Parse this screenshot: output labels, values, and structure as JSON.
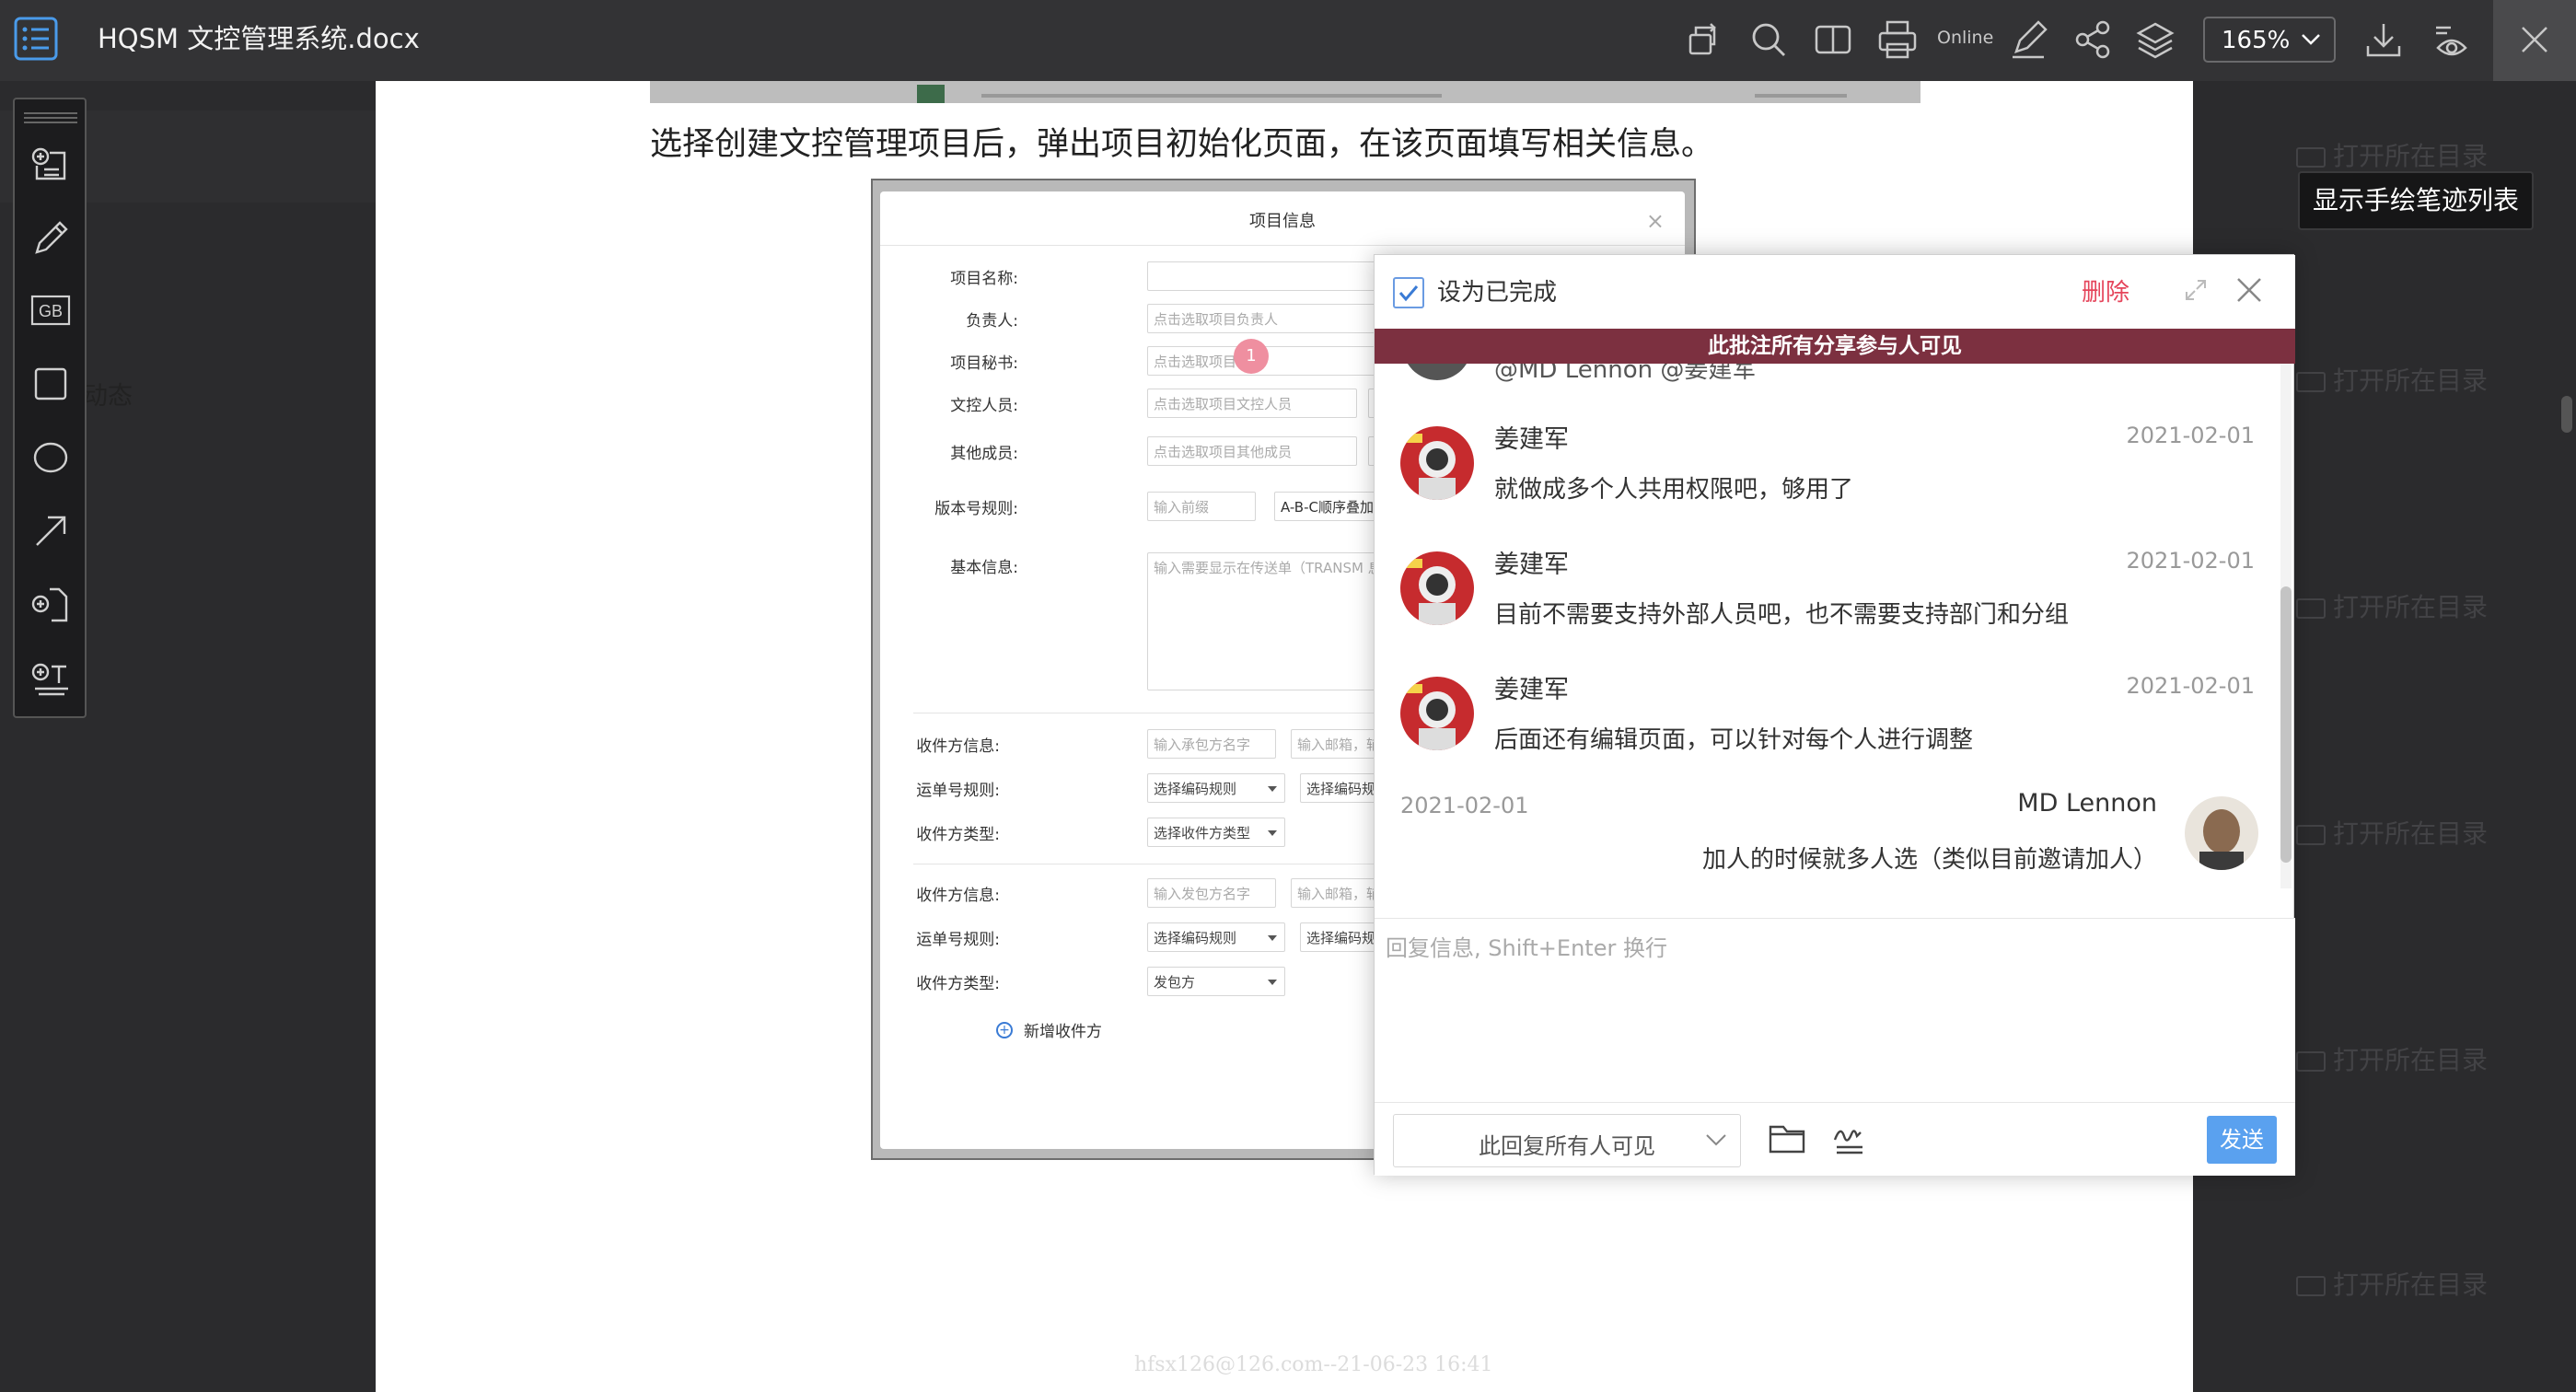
{
  "topbar": {
    "title": "HQSM 文控管理系统.docx",
    "online_label": "Online",
    "zoom": "165%",
    "icons": [
      "rotate-icon",
      "search-icon",
      "split-view-icon",
      "print-icon",
      "pen-icon",
      "share-icon",
      "layers-icon",
      "download-icon",
      "eye-settings-icon",
      "close-icon"
    ]
  },
  "left": {
    "partial_text": "动态",
    "tools": [
      "add-note-icon",
      "pencil-icon",
      "gb-stamp-icon",
      "rectangle-icon",
      "ellipse-icon",
      "arrow-icon",
      "add-attachment-icon",
      "add-text-icon"
    ],
    "gb_label": "GB"
  },
  "document": {
    "heading": "选择创建文控管理项目后，弹出项目初始化页面，在该页面填写相关信息。",
    "watermark": "hfsx126@126.com--21-06-23 16:41",
    "dialog": {
      "title": "项目信息",
      "marker": "1",
      "fields": [
        {
          "label": "项目名称:",
          "value": ""
        },
        {
          "label": "负责人:",
          "value": "点击选取项目负责人"
        },
        {
          "label": "项目秘书:",
          "value": "点击选取项目秘书"
        },
        {
          "label": "文控人员:",
          "value": "点击选取项目文控人员"
        },
        {
          "label": "其他成员:",
          "value": "点击选取项目其他成员"
        },
        {
          "label": "版本号规则:",
          "value": "输入前缀",
          "extra": "A-B-C顺序叠加"
        },
        {
          "label": "基本信息:",
          "value": "输入需要显示在传送单（TRANSM 息。如联系方式，地址，电话等。"
        }
      ],
      "recv1": [
        {
          "label": "收件方信息:",
          "value": "输入承包方名字",
          "extra": "输入邮箱，辅"
        },
        {
          "label": "运单号规则:",
          "value": "选择编码规则",
          "extra": "选择编码规"
        },
        {
          "label": "收件方类型:",
          "value": "选择收件方类型"
        }
      ],
      "recv2": [
        {
          "label": "收件方信息:",
          "value": "输入发包方名字",
          "extra": "输入邮箱，辅"
        },
        {
          "label": "运单号规则:",
          "value": "选择编码规则",
          "extra": "选择编码规"
        },
        {
          "label": "收件方类型:",
          "value": "发包方"
        }
      ],
      "add_recipient": "新增收件方"
    }
  },
  "right": {
    "tooltip": "显示手绘笔迹列表",
    "open_dir": "打开所在目录"
  },
  "comment_panel": {
    "done_label": "设为已完成",
    "delete_label": "删除",
    "banner": "此批注所有分享参与人可见",
    "cut_text": "@MD Lennon @姜建军",
    "messages": [
      {
        "name": "姜建军",
        "date": "2021-02-01",
        "text": "就做成多个人共用权限吧，够用了"
      },
      {
        "name": "姜建军",
        "date": "2021-02-01",
        "text": "目前不需要支持外部人员吧，也不需要支持部门和分组"
      },
      {
        "name": "姜建军",
        "date": "2021-02-01",
        "text": "后面还有编辑页面，可以针对每个人进行调整"
      }
    ],
    "mine": {
      "name": "MD Lennon",
      "date": "2021-02-01",
      "text": "加人的时候就多人选（类似目前邀请加人）"
    },
    "reply_placeholder": "回复信息, Shift+Enter 换行",
    "visibility": "此回复所有人可见",
    "send_label": "发送"
  }
}
